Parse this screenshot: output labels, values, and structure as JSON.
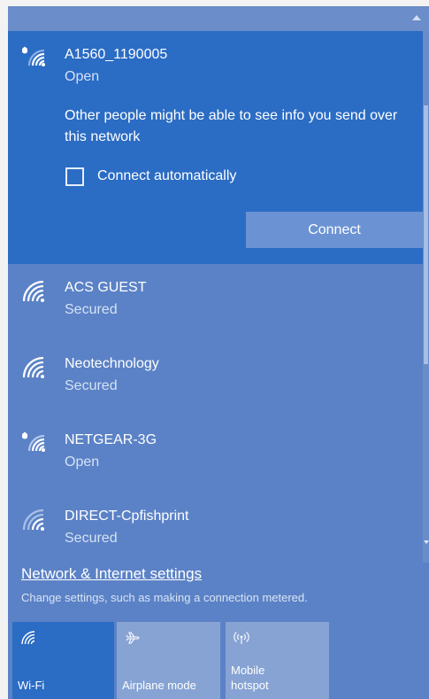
{
  "connected_network": {
    "name": "A1560_1190005",
    "status": "Open",
    "warning": "Other people might be able to see info you send over this network",
    "auto_connect_label": "Connect automatically",
    "auto_connect_checked": false,
    "connect_label": "Connect"
  },
  "networks": [
    {
      "name": "ACS GUEST",
      "status": "Secured",
      "shield": false
    },
    {
      "name": "Neotechnology",
      "status": "Secured",
      "shield": false
    },
    {
      "name": "NETGEAR-3G",
      "status": "Open",
      "shield": true
    },
    {
      "name": "DIRECT-Cpfishprint",
      "status": "Secured",
      "shield": false
    }
  ],
  "settings": {
    "link": "Network & Internet settings",
    "subtitle": "Change settings, such as making a connection metered."
  },
  "quick_actions": [
    {
      "label": "Wi-Fi",
      "icon": "wifi-icon",
      "active": true
    },
    {
      "label": "Airplane mode",
      "icon": "airplane-icon",
      "active": false
    },
    {
      "label": "Mobile hotspot",
      "icon": "hotspot-icon",
      "active": false
    }
  ],
  "colors": {
    "accent": "#2b6cc4",
    "panel": "#5b82c6",
    "tile_inactive": "#87a3d4"
  }
}
